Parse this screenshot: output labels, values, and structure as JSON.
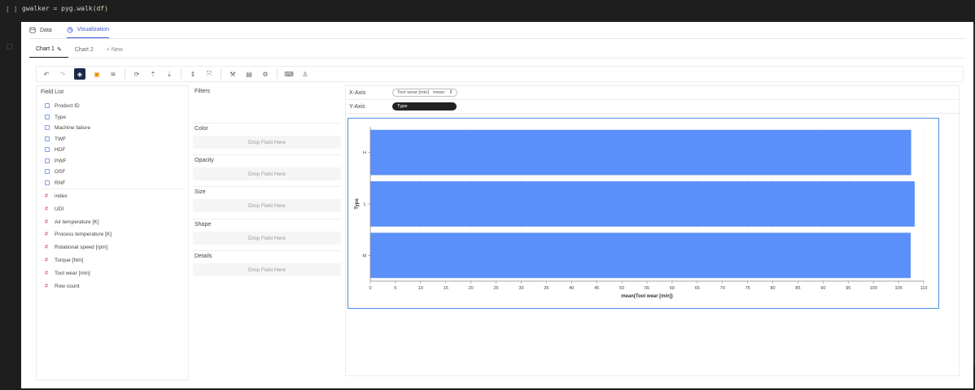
{
  "notebook": {
    "prompt": "[ ]",
    "code_prefix": "gwalker = pyg.walk(",
    "code_arg": "df",
    "code_suffix": ")"
  },
  "tabs": {
    "data": "Data",
    "visualization": "Visualization"
  },
  "chart_tabs": {
    "chart1": "Chart 1",
    "chart2": "Chart 2",
    "new": "+ New"
  },
  "field_list": {
    "title": "Field List",
    "dimensions": [
      "Product ID",
      "Type",
      "Machine failure",
      "TWF",
      "HDF",
      "PWF",
      "OSF",
      "RNF"
    ],
    "measures": [
      "index",
      "UDI",
      "Air temperature [K]",
      "Process temperature [K]",
      "Rotational speed [rpm]",
      "Torque [Nm]",
      "Tool wear [min]",
      "Row count"
    ]
  },
  "filters": {
    "title": "Filters",
    "sections": [
      {
        "title": "Color",
        "drop": "Drop Field Here"
      },
      {
        "title": "Opacity",
        "drop": "Drop Field Here"
      },
      {
        "title": "Size",
        "drop": "Drop Field Here"
      },
      {
        "title": "Shape",
        "drop": "Drop Field Here"
      },
      {
        "title": "Details",
        "drop": "Drop Field Here"
      }
    ]
  },
  "axes": {
    "x_label": "X-Axis",
    "x_field": "Tool wear [min]",
    "x_agg": "mean",
    "y_label": "Y-Axis",
    "y_field": "Type"
  },
  "chart_data": {
    "type": "bar",
    "orientation": "horizontal",
    "categories": [
      "H",
      "L",
      "M"
    ],
    "values": [
      107.5,
      108.2,
      107.4
    ],
    "xlabel": "mean(Tool wear [min])",
    "ylabel": "Type",
    "xlim": [
      0,
      110
    ],
    "xticks": [
      0,
      5,
      10,
      15,
      20,
      25,
      30,
      35,
      40,
      45,
      50,
      55,
      60,
      65,
      70,
      75,
      80,
      85,
      90,
      95,
      100,
      105,
      110
    ],
    "color": "#5b8ff9"
  }
}
